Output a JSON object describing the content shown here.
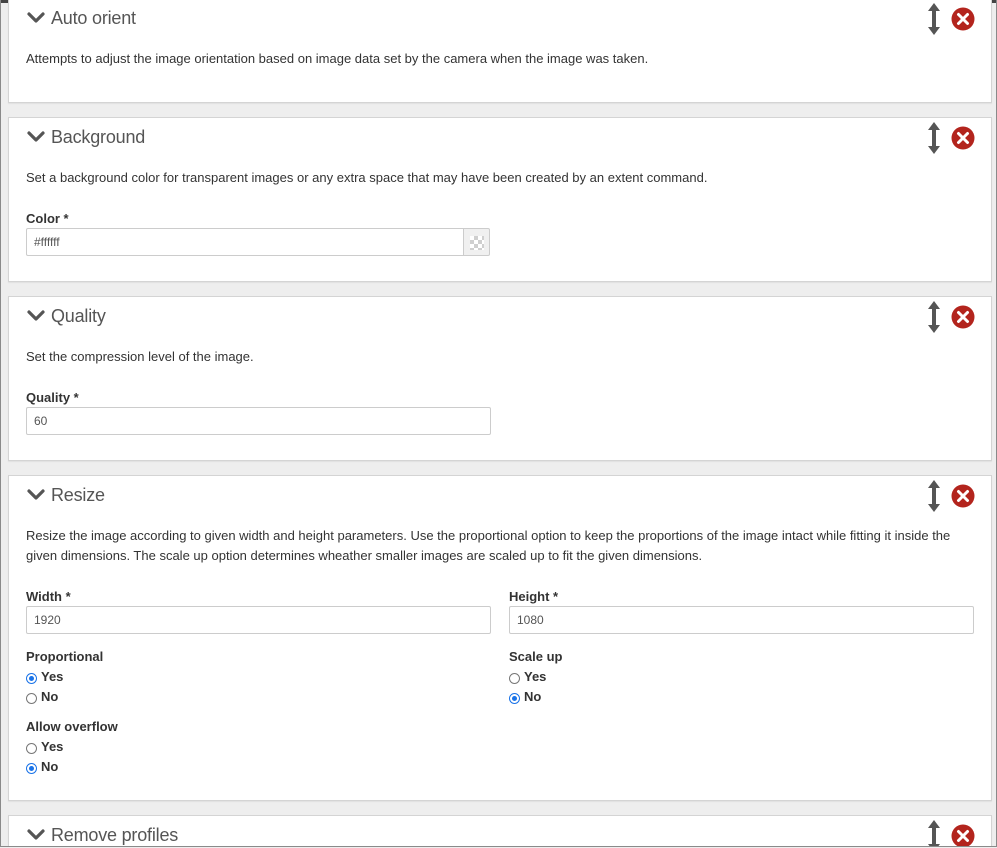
{
  "colors": {
    "remove_red": "#b3241d",
    "radio_blue": "#1a73e8"
  },
  "icons": {
    "collapse": "chevron-down-icon",
    "reorder": "drag-arrows-icon",
    "remove": "remove-circle-icon"
  },
  "panels": {
    "auto_orient": {
      "title": "Auto orient",
      "description": "Attempts to adjust the image orientation based on image data set by the camera when the image was taken."
    },
    "background": {
      "title": "Background",
      "description": "Set a background color for transparent images or any extra space that may have been created by an extent command.",
      "color_label": "Color *",
      "color_value": "#ffffff"
    },
    "quality": {
      "title": "Quality",
      "description": "Set the compression level of the image.",
      "quality_label": "Quality *",
      "quality_value": "60"
    },
    "resize": {
      "title": "Resize",
      "description": "Resize the image according to given width and height parameters. Use the proportional option to keep the proportions of the image intact while fitting it inside the given dimensions. The scale up option determines wheather smaller images are scaled up to fit the given dimensions.",
      "width_label": "Width *",
      "width_value": "1920",
      "height_label": "Height *",
      "height_value": "1080",
      "proportional": {
        "label": "Proportional",
        "yes": "Yes",
        "no": "No",
        "selected": "Yes"
      },
      "scale_up": {
        "label": "Scale up",
        "yes": "Yes",
        "no": "No",
        "selected": "No"
      },
      "allow_overflow": {
        "label": "Allow overflow",
        "yes": "Yes",
        "no": "No",
        "selected": "No"
      }
    },
    "remove_profiles": {
      "title": "Remove profiles"
    }
  }
}
